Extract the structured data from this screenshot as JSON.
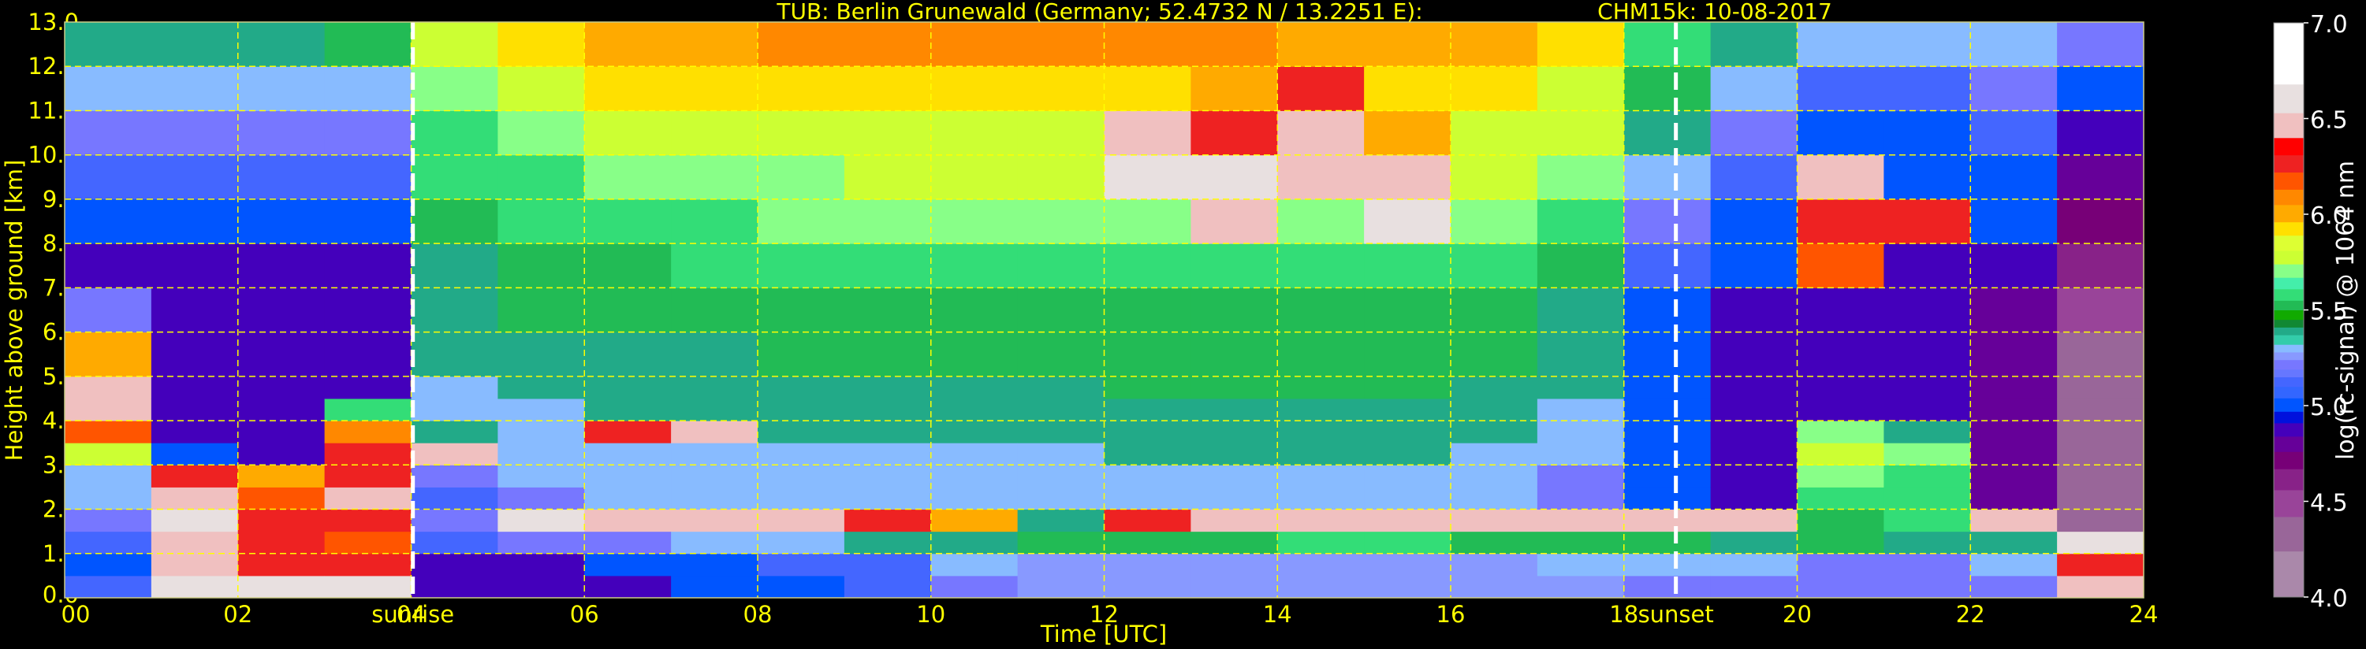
{
  "title": "TUB: Berlin Grunewald (Germany; 52.4732 N / 13.2251 E):",
  "instrument": "CHM15k: 10-08-2017",
  "chart_data": {
    "type": "heatmap",
    "title": "TUB: Berlin Grunewald (Germany; 52.4732 N / 13.2251 E):    CHM15k: 10-08-2017",
    "xlabel": "Time [UTC]",
    "ylabel": "Height above ground [km]",
    "xlim": [
      0,
      24
    ],
    "ylim": [
      0,
      13
    ],
    "grid": true,
    "x_ticks": [
      "00",
      "02",
      "04",
      "06",
      "08",
      "10",
      "12",
      "14",
      "16",
      "18",
      "20",
      "22",
      "24"
    ],
    "y_ticks": [
      "0.0",
      "1.0",
      "2.0",
      "3.0",
      "4.0",
      "5.0",
      "6.0",
      "7.0",
      "8.0",
      "9.0",
      "10.0",
      "11.0",
      "12.0",
      "13.0"
    ],
    "annotations": [
      {
        "label": "sunrise",
        "time_utc": 4.02
      },
      {
        "label": "sunset",
        "time_utc": 18.6
      }
    ],
    "time_bins": [
      0,
      1,
      2,
      3,
      4,
      5,
      6,
      7,
      8,
      9,
      10,
      11,
      12,
      13,
      14,
      15,
      16,
      17,
      18,
      19,
      20,
      21,
      22,
      23,
      24
    ],
    "height_bins_km": [
      0,
      0.5,
      1,
      1.5,
      2,
      2.5,
      3,
      3.5,
      4,
      4.5,
      5,
      6,
      7,
      8,
      9,
      10,
      11,
      12,
      13
    ],
    "z_description": "log(rc-signal) @ 1064 nm, one column per hour, bottom to top",
    "z": [
      [
        5.1,
        5.0,
        5.1,
        5.2,
        5.3,
        5.3,
        5.8,
        6.2,
        6.5,
        6.5,
        6.0,
        5.2,
        4.9,
        5.0,
        5.1,
        5.2,
        5.3,
        5.4
      ],
      [
        6.6,
        6.5,
        6.5,
        6.6,
        6.5,
        6.3,
        5.0,
        4.9,
        4.9,
        4.9,
        4.9,
        4.9,
        4.9,
        5.0,
        5.1,
        5.2,
        5.3,
        5.4
      ],
      [
        6.6,
        6.3,
        6.3,
        6.3,
        6.2,
        6.0,
        4.9,
        4.9,
        4.9,
        4.9,
        4.9,
        4.9,
        4.9,
        5.0,
        5.1,
        5.2,
        5.3,
        5.4
      ],
      [
        6.6,
        6.3,
        6.2,
        6.3,
        6.4,
        6.3,
        6.3,
        6.1,
        5.6,
        4.9,
        4.9,
        4.9,
        4.9,
        5.0,
        5.1,
        5.2,
        5.3,
        5.5
      ],
      [
        4.9,
        4.9,
        5.1,
        5.2,
        5.1,
        5.2,
        6.5,
        5.4,
        5.3,
        5.3,
        5.4,
        5.4,
        5.4,
        5.5,
        5.6,
        5.6,
        5.7,
        5.8
      ],
      [
        4.9,
        4.9,
        5.2,
        6.6,
        5.2,
        5.3,
        5.3,
        5.3,
        5.3,
        5.4,
        5.4,
        5.5,
        5.5,
        5.6,
        5.6,
        5.7,
        5.8,
        5.9
      ],
      [
        4.9,
        5.0,
        5.2,
        6.4,
        5.3,
        5.3,
        5.3,
        6.3,
        5.4,
        5.4,
        5.4,
        5.5,
        5.5,
        5.6,
        5.7,
        5.8,
        5.9,
        6.0
      ],
      [
        5.0,
        5.0,
        5.3,
        6.5,
        5.3,
        5.3,
        5.3,
        6.4,
        5.4,
        5.4,
        5.4,
        5.5,
        5.6,
        5.6,
        5.7,
        5.8,
        5.9,
        6.0
      ],
      [
        5.0,
        5.1,
        5.3,
        6.4,
        5.3,
        5.3,
        5.3,
        5.4,
        5.4,
        5.4,
        5.5,
        5.5,
        5.6,
        5.7,
        5.7,
        5.8,
        5.9,
        6.1
      ],
      [
        5.1,
        5.1,
        5.4,
        6.3,
        5.3,
        5.3,
        5.3,
        5.4,
        5.4,
        5.4,
        5.5,
        5.5,
        5.6,
        5.7,
        5.8,
        5.8,
        5.9,
        6.1
      ],
      [
        5.2,
        5.3,
        5.4,
        6.0,
        5.3,
        5.3,
        5.3,
        5.4,
        5.4,
        5.4,
        5.5,
        5.5,
        5.6,
        5.7,
        5.8,
        5.8,
        5.9,
        6.1
      ],
      [
        5.25,
        5.25,
        5.5,
        5.4,
        5.3,
        5.3,
        5.3,
        5.4,
        5.4,
        5.4,
        5.5,
        5.5,
        5.6,
        5.7,
        5.8,
        5.8,
        5.9,
        6.1
      ],
      [
        5.25,
        5.25,
        5.5,
        6.3,
        5.3,
        5.3,
        5.4,
        5.4,
        5.4,
        5.5,
        5.5,
        5.5,
        5.6,
        5.7,
        6.6,
        6.4,
        5.9,
        6.1
      ],
      [
        5.25,
        5.25,
        5.5,
        6.4,
        5.3,
        5.3,
        5.4,
        5.4,
        5.4,
        5.5,
        5.5,
        5.5,
        5.6,
        6.4,
        6.6,
        6.3,
        6.0,
        6.1
      ],
      [
        5.25,
        5.25,
        5.55,
        6.4,
        5.3,
        5.3,
        5.4,
        5.4,
        5.4,
        5.5,
        5.5,
        5.5,
        5.6,
        5.7,
        6.5,
        6.5,
        6.3,
        6.0
      ],
      [
        5.25,
        5.25,
        5.55,
        6.4,
        5.3,
        5.3,
        5.4,
        5.4,
        5.4,
        5.5,
        5.5,
        5.5,
        5.6,
        6.6,
        6.5,
        6.0,
        5.9,
        6.0
      ],
      [
        5.25,
        5.25,
        5.5,
        6.5,
        5.3,
        5.3,
        5.3,
        5.4,
        5.4,
        5.4,
        5.5,
        5.5,
        5.6,
        5.7,
        5.8,
        5.8,
        5.9,
        6.0
      ],
      [
        5.25,
        5.3,
        5.5,
        6.5,
        5.2,
        5.2,
        5.3,
        5.3,
        5.3,
        5.4,
        5.4,
        5.4,
        5.5,
        5.6,
        5.7,
        5.8,
        5.8,
        5.9
      ],
      [
        5.2,
        5.3,
        5.5,
        6.4,
        5.0,
        5.0,
        5.0,
        5.0,
        5.0,
        5.0,
        5.0,
        5.0,
        5.1,
        5.2,
        5.3,
        5.4,
        5.5,
        5.6
      ],
      [
        5.2,
        5.3,
        5.4,
        6.5,
        4.9,
        4.9,
        4.9,
        4.9,
        4.9,
        4.9,
        4.9,
        4.9,
        5.0,
        5.0,
        5.1,
        5.2,
        5.3,
        5.4
      ],
      [
        5.2,
        5.2,
        5.5,
        5.5,
        5.6,
        5.7,
        5.8,
        5.7,
        4.9,
        4.9,
        4.9,
        4.9,
        6.2,
        6.3,
        6.4,
        5.0,
        5.1,
        5.3
      ],
      [
        5.2,
        5.2,
        5.4,
        5.6,
        5.6,
        5.6,
        5.7,
        5.4,
        4.9,
        4.9,
        4.9,
        4.9,
        4.9,
        6.3,
        5.0,
        5.0,
        5.1,
        5.3
      ],
      [
        5.2,
        5.3,
        5.4,
        6.5,
        4.8,
        4.8,
        4.8,
        4.8,
        4.8,
        4.8,
        4.8,
        4.8,
        4.9,
        5.0,
        5.0,
        5.1,
        5.2,
        5.3
      ],
      [
        6.5,
        6.3,
        6.6,
        4.4,
        4.4,
        4.4,
        4.4,
        4.4,
        4.4,
        4.4,
        4.4,
        4.5,
        4.6,
        4.7,
        4.8,
        4.9,
        5.0,
        5.2
      ]
    ],
    "colorbar": {
      "label": "log(rc-signal) @ 1064 nm",
      "range": [
        4.0,
        7.0
      ],
      "ticks": [
        "4.0",
        "4.5",
        "5.0",
        "5.5",
        "6.0",
        "6.5",
        "7.0"
      ],
      "levels": [
        4.0,
        4.24,
        4.42,
        4.56,
        4.67,
        4.76,
        4.84,
        4.91,
        4.97,
        5.04,
        5.1,
        5.15,
        5.19,
        5.24,
        5.28,
        5.32,
        5.37,
        5.41,
        5.45,
        5.5,
        5.55,
        5.61,
        5.67,
        5.74,
        5.81,
        5.89,
        5.96,
        6.05,
        6.13,
        6.22,
        6.31,
        6.4,
        6.53,
        6.68,
        7.0
      ],
      "colors": [
        "#aa88aa",
        "#996699",
        "#994499",
        "#882288",
        "#770077",
        "#660099",
        "#4400bb",
        "#0011dd",
        "#0055ff",
        "#3366ff",
        "#4466ff",
        "#6677ff",
        "#7777ff",
        "#8899ff",
        "#88bbff",
        "#33ccaa",
        "#22aa88",
        "#118833",
        "#11aa00",
        "#22bb55",
        "#33dd77",
        "#44eeaa",
        "#88ff88",
        "#ccff33",
        "#ddff33",
        "#ffe000",
        "#ffaa00",
        "#ff8800",
        "#ff5500",
        "#ee2222",
        "#ff0000",
        "#f0c0c0",
        "#e8e0e0",
        "#ffffff"
      ]
    }
  }
}
